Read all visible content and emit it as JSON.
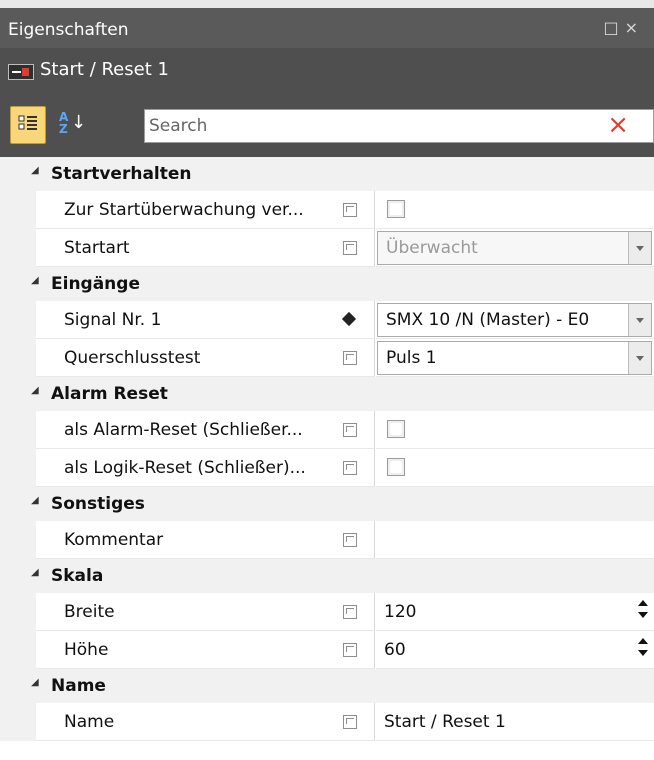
{
  "window": {
    "title": "Eigenschaften",
    "object_name": "Start / Reset 1"
  },
  "toolbar": {
    "search_placeholder": "Search",
    "buttons": [
      "categorized-view",
      "alphabetical-sort",
      "clear-search"
    ]
  },
  "categories": {
    "startverhalten": {
      "label": "Startverhalten",
      "rows": [
        {
          "name": "Zur Startüberwachung ver...",
          "value_type": "checkbox",
          "checked": false
        },
        {
          "name": "Startart",
          "value": "Überwacht",
          "value_type": "dropdown",
          "disabled": true
        }
      ]
    },
    "eingaenge": {
      "label": "Eingänge",
      "rows": [
        {
          "name": "Signal Nr. 1",
          "value": "SMX 10 /N (Master) - E0",
          "value_type": "dropdown"
        },
        {
          "name": "Querschlusstest",
          "value": "Puls 1",
          "value_type": "dropdown"
        }
      ]
    },
    "alarm_reset": {
      "label": "Alarm Reset",
      "rows": [
        {
          "name": "als Alarm-Reset (Schließer...",
          "value_type": "checkbox",
          "checked": false
        },
        {
          "name": "als Logik-Reset (Schließer)...",
          "value_type": "checkbox",
          "checked": false
        }
      ]
    },
    "sonstiges": {
      "label": "Sonstiges",
      "rows": [
        {
          "name": "Kommentar",
          "value": "",
          "value_type": "text"
        }
      ]
    },
    "skala": {
      "label": "Skala",
      "rows": [
        {
          "name": "Breite",
          "value": "120",
          "value_type": "number"
        },
        {
          "name": "Höhe",
          "value": "60",
          "value_type": "number"
        }
      ]
    },
    "name": {
      "label": "Name",
      "rows": [
        {
          "name": "Name",
          "value": "Start / Reset 1",
          "value_type": "text"
        }
      ]
    }
  },
  "colors": {
    "title_bg": "#5a5a5a",
    "toolbar_bg": "#4f4f4f",
    "category_bg": "#f1f1f1",
    "selected_button": "#f8d67a",
    "clear_icon": "#e53a2e"
  }
}
